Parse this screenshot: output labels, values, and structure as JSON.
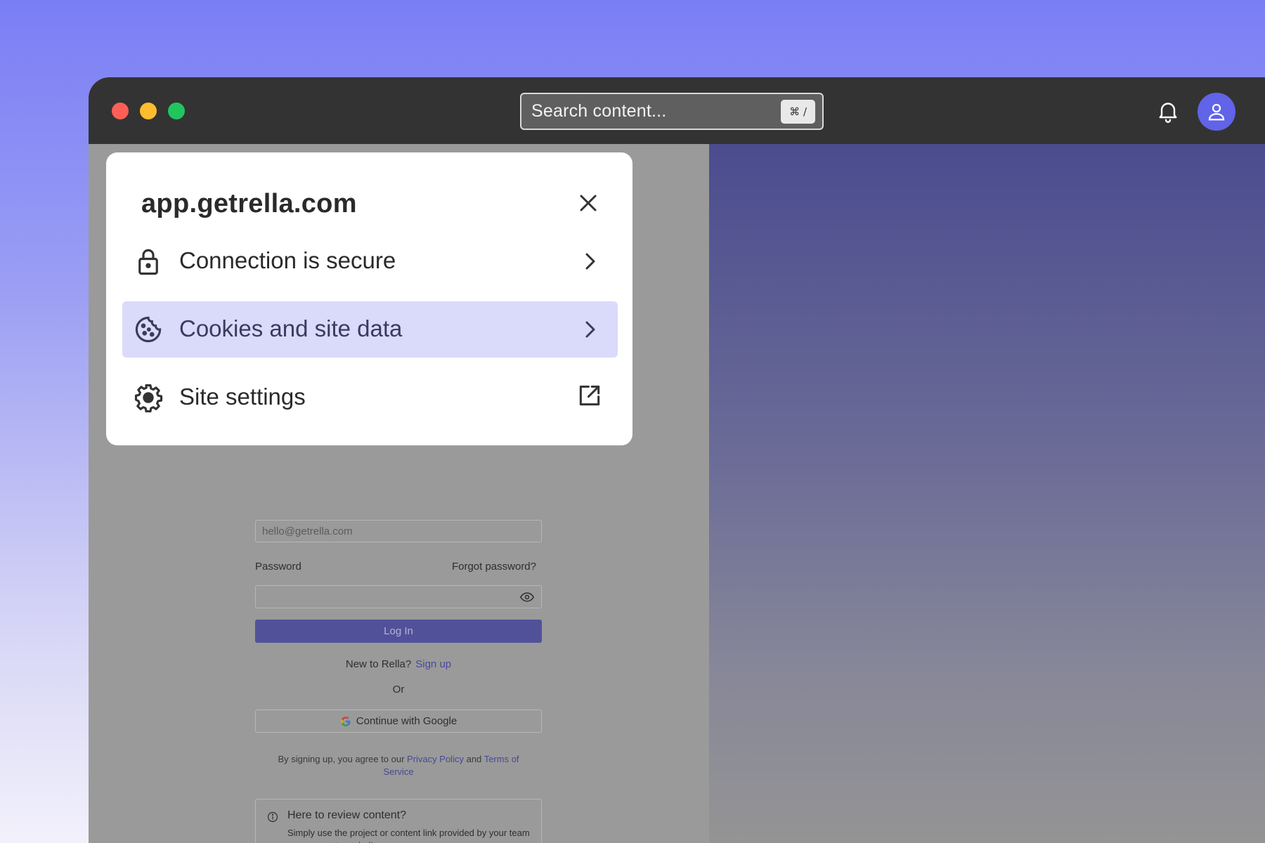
{
  "titlebar": {
    "search_placeholder": "Search content...",
    "search_shortcut": "⌘ /",
    "icons": [
      "bell-icon",
      "user-icon"
    ]
  },
  "popup": {
    "domain": "app.getrella.com",
    "items": [
      {
        "label": "Connection is secure",
        "icon": "lock-icon",
        "trailing": "chevron-right-icon"
      },
      {
        "label": "Cookies and site data",
        "icon": "cookie-icon",
        "trailing": "chevron-right-icon",
        "highlighted": true
      },
      {
        "label": "Site settings",
        "icon": "gear-icon",
        "trailing": "external-link-icon"
      }
    ]
  },
  "login": {
    "email_value": "hello@getrella.com",
    "password_label": "Password",
    "forgot_label": "Forgot password?",
    "login_button": "Log In",
    "new_to": "New to Rella?",
    "signup_link": "Sign up",
    "or": "Or",
    "google_button": "Continue with Google",
    "terms_prefix": "By signing up, you agree to our",
    "privacy_link": "Privacy Policy",
    "terms_and": "and",
    "terms_link": "Terms of Service",
    "review_title": "Here to review content?",
    "review_body": "Simply use the project or content link provided by your team - no account needed!"
  },
  "colors": {
    "accent": "#6163e8",
    "highlight": "#dadafb",
    "titlebar": "#333333"
  }
}
